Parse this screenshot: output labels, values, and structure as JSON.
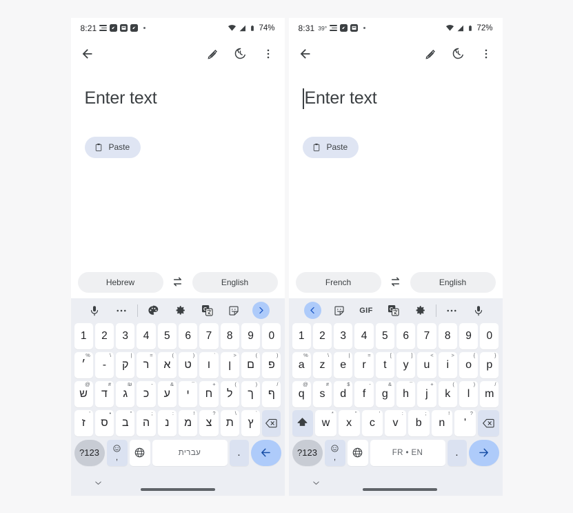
{
  "phones": [
    {
      "id": "left",
      "status": {
        "time": "8:21",
        "temp": "",
        "battery": "74%",
        "icons": [
          "menu-lines-icon",
          "app-badge-icon",
          "calendar-icon",
          "app-badge-icon",
          "more-dot-icon"
        ],
        "right_icons": [
          "wifi-icon",
          "signal-icon",
          "battery-icon"
        ]
      },
      "appbar": {
        "back": "back-arrow-icon",
        "actions": [
          "handwriting-icon",
          "history-icon",
          "overflow-menu-icon"
        ]
      },
      "content": {
        "placeholder": "Enter text",
        "caret_visible": false,
        "paste_label": "Paste"
      },
      "language": {
        "source": "Hebrew",
        "target": "English",
        "swap": "swap-arrows-icon"
      },
      "toolbar": [
        {
          "name": "mic-icon",
          "type": "icon"
        },
        {
          "name": "overflow-dots-icon",
          "type": "icon"
        },
        {
          "name": "divider",
          "type": "divider"
        },
        {
          "name": "theme-palette-icon",
          "type": "icon"
        },
        {
          "name": "settings-gear-icon",
          "type": "icon"
        },
        {
          "name": "translate-icon",
          "type": "icon"
        },
        {
          "name": "sticker-icon",
          "type": "icon"
        },
        {
          "name": "expand-chevron-right-icon",
          "type": "round"
        }
      ],
      "keyboard": {
        "rows": [
          [
            {
              "main": "1"
            },
            {
              "main": "2"
            },
            {
              "main": "3"
            },
            {
              "main": "4"
            },
            {
              "main": "5"
            },
            {
              "main": "6"
            },
            {
              "main": "7"
            },
            {
              "main": "8"
            },
            {
              "main": "9"
            },
            {
              "main": "0"
            }
          ],
          [
            {
              "main": "׳",
              "hint": "%"
            },
            {
              "main": "-",
              "hint": "\\"
            },
            {
              "main": "ק",
              "hint": "|"
            },
            {
              "main": "ר",
              "hint": "="
            },
            {
              "main": "א",
              "hint": "("
            },
            {
              "main": "ט",
              "hint": ")"
            },
            {
              "main": "ו",
              "hint": "`"
            },
            {
              "main": "ן",
              "hint": ">"
            },
            {
              "main": "ם",
              "hint": "("
            },
            {
              "main": "פ",
              "hint": ")"
            }
          ],
          [
            {
              "main": "ש",
              "hint": "@"
            },
            {
              "main": "ד",
              "hint": "#"
            },
            {
              "main": "ג",
              "hint": "₪"
            },
            {
              "main": "כ",
              "hint": "-"
            },
            {
              "main": "ע",
              "hint": "&"
            },
            {
              "main": "י",
              "hint": "¯"
            },
            {
              "main": "ח",
              "hint": "+"
            },
            {
              "main": "ל",
              "hint": "("
            },
            {
              "main": "ך",
              "hint": ")"
            },
            {
              "main": "ף",
              "hint": "/"
            }
          ],
          [
            {
              "main": "ז",
              "hint": "'"
            },
            {
              "main": "ס",
              "hint": "•"
            },
            {
              "main": "ב",
              "hint": "\""
            },
            {
              "main": "ה",
              "hint": ";"
            },
            {
              "main": "נ",
              "hint": ":"
            },
            {
              "main": "מ",
              "hint": "!"
            },
            {
              "main": "צ",
              "hint": "?"
            },
            {
              "main": "ת",
              "hint": "\\"
            },
            {
              "main": "ץ",
              "hint": "`"
            },
            {
              "main": "backspace-icon",
              "func": true
            }
          ]
        ],
        "bottom": {
          "symbols": "?123",
          "emoji": "emoji-icon",
          "comma": ",",
          "globe": "globe-language-icon",
          "space_label": "עברית",
          "period": ".",
          "action": "arrow-left-icon"
        }
      },
      "nav": {
        "chevron": "collapse-keyboard-chevron-icon",
        "gesture": "gesture-bar"
      }
    },
    {
      "id": "right",
      "status": {
        "time": "8:31",
        "temp": "39°",
        "battery": "72%",
        "icons": [
          "menu-lines-icon",
          "app-badge-icon",
          "calendar-icon",
          "more-dot-icon"
        ],
        "right_icons": [
          "wifi-icon",
          "signal-icon",
          "battery-icon"
        ]
      },
      "appbar": {
        "back": "back-arrow-icon",
        "actions": [
          "handwriting-icon",
          "history-icon",
          "overflow-menu-icon"
        ]
      },
      "content": {
        "placeholder": "Enter text",
        "caret_visible": true,
        "paste_label": "Paste"
      },
      "language": {
        "source": "French",
        "target": "English",
        "swap": "swap-arrows-icon"
      },
      "toolbar": [
        {
          "name": "collapse-chevron-left-icon",
          "type": "round"
        },
        {
          "name": "sticker-icon",
          "type": "icon"
        },
        {
          "name": "gif-icon",
          "type": "text",
          "label": "GIF"
        },
        {
          "name": "translate-icon",
          "type": "icon"
        },
        {
          "name": "settings-gear-icon",
          "type": "icon"
        },
        {
          "name": "divider",
          "type": "divider"
        },
        {
          "name": "overflow-dots-icon",
          "type": "icon"
        },
        {
          "name": "mic-icon",
          "type": "icon"
        }
      ],
      "keyboard": {
        "rows": [
          [
            {
              "main": "1"
            },
            {
              "main": "2"
            },
            {
              "main": "3"
            },
            {
              "main": "4"
            },
            {
              "main": "5"
            },
            {
              "main": "6"
            },
            {
              "main": "7"
            },
            {
              "main": "8"
            },
            {
              "main": "9"
            },
            {
              "main": "0"
            }
          ],
          [
            {
              "main": "a",
              "hint": "%"
            },
            {
              "main": "z",
              "hint": "\\"
            },
            {
              "main": "e",
              "hint": "|"
            },
            {
              "main": "r",
              "hint": "="
            },
            {
              "main": "t",
              "hint": "["
            },
            {
              "main": "y",
              "hint": "]"
            },
            {
              "main": "u",
              "hint": "<"
            },
            {
              "main": "i",
              "hint": ">"
            },
            {
              "main": "o",
              "hint": "{"
            },
            {
              "main": "p",
              "hint": "}"
            }
          ],
          [
            {
              "main": "q",
              "hint": "@"
            },
            {
              "main": "s",
              "hint": "#"
            },
            {
              "main": "d",
              "hint": "$"
            },
            {
              "main": "f",
              "hint": "-"
            },
            {
              "main": "g",
              "hint": "&"
            },
            {
              "main": "h",
              "hint": "¯"
            },
            {
              "main": "j",
              "hint": "+"
            },
            {
              "main": "k",
              "hint": "("
            },
            {
              "main": "l",
              "hint": ")"
            },
            {
              "main": "m",
              "hint": "/"
            }
          ],
          [
            {
              "main": "shift-icon",
              "func": true
            },
            {
              "main": "w",
              "hint": "*"
            },
            {
              "main": "x",
              "hint": "\""
            },
            {
              "main": "c",
              "hint": "'"
            },
            {
              "main": "v",
              "hint": ":"
            },
            {
              "main": "b",
              "hint": ";"
            },
            {
              "main": "n",
              "hint": "!"
            },
            {
              "main": "'",
              "hint": "?"
            },
            {
              "main": "backspace-icon",
              "func": true
            }
          ]
        ],
        "bottom": {
          "symbols": "?123",
          "emoji": "emoji-icon",
          "comma": ",",
          "globe": "globe-language-icon",
          "space_label": "FR • EN",
          "period": ".",
          "action": "arrow-right-icon"
        }
      },
      "nav": {
        "chevron": "collapse-keyboard-chevron-icon",
        "gesture": "gesture-bar"
      }
    }
  ],
  "colors": {
    "accent": "#aecbfa",
    "key_bg": "#ffffff",
    "func_key_bg": "#dbe2f1",
    "keyboard_bg": "#eceef3",
    "chip_bg": "#dfe5f3",
    "text": "#202124"
  }
}
